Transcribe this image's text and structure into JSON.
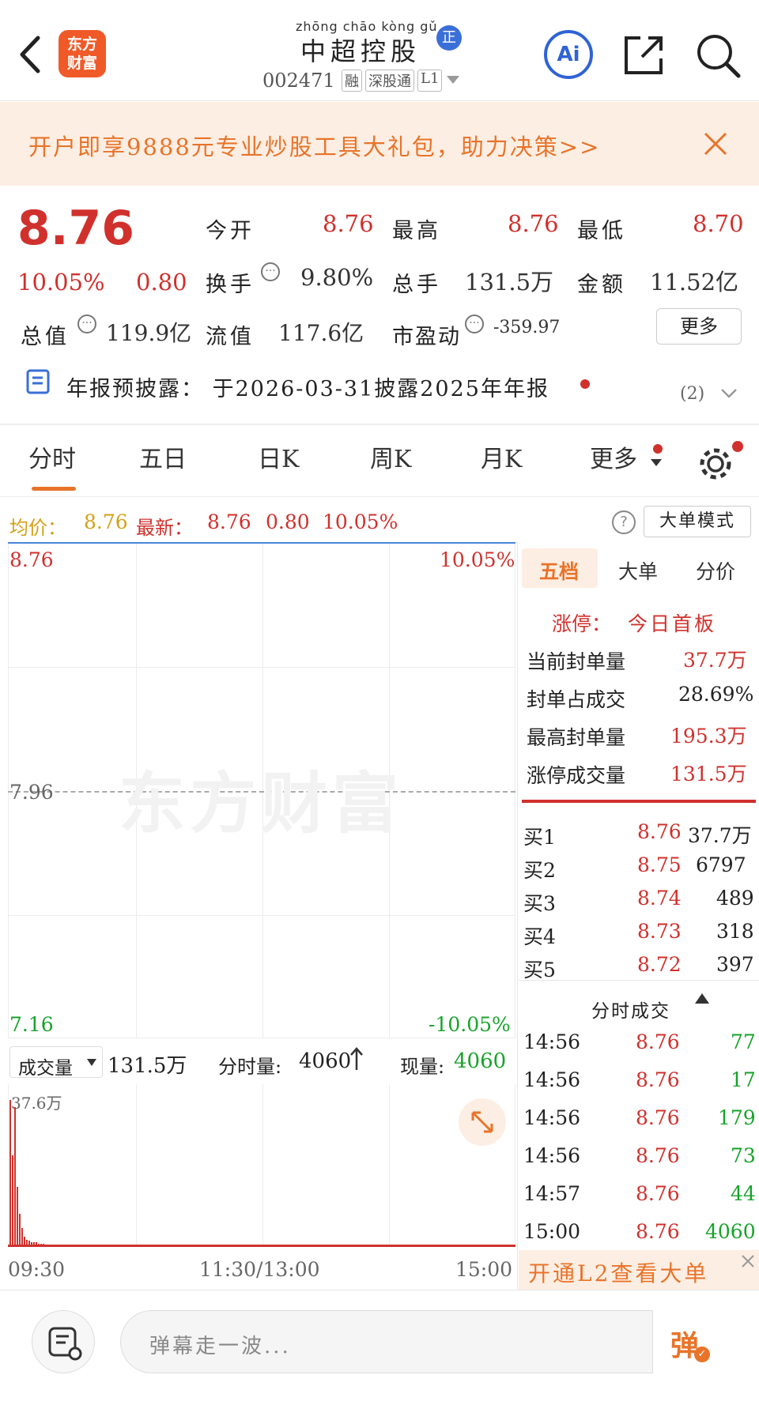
{
  "header": {
    "stock_name_pinyin": "zhōng chāo kòng gǔ",
    "stock_name": "中超控股",
    "badge": "正",
    "code": "002471",
    "tags": [
      "融",
      "深股通",
      "L1"
    ],
    "logo_text": "东方财富",
    "ai_label": "Ai"
  },
  "banner": {
    "text": "开户即享9888元专业炒股工具大礼包，助力决策>>"
  },
  "quote": {
    "price": "8.76",
    "change_pct": "10.05%",
    "change": "0.80",
    "open_label": "今开",
    "open": "8.76",
    "high_label": "最高",
    "high": "8.76",
    "low_label": "最低",
    "low": "8.70",
    "turnover_label": "换手",
    "turnover": "9.80%",
    "volume_label": "总手",
    "volume": "131.5万",
    "amount_label": "金额",
    "amount": "11.52亿",
    "mktcap_label": "总值",
    "mktcap": "119.9亿",
    "float_label": "流值",
    "float": "117.6亿",
    "pe_label": "市盈动",
    "pe": "-359.97",
    "more_label": "更多"
  },
  "notice": {
    "text": "年报预披露：  于2026-03-31披露2025年年报",
    "count": "(2)"
  },
  "tabs": {
    "items": [
      "分时",
      "五日",
      "日K",
      "周K",
      "月K",
      "更多"
    ],
    "active": "分时"
  },
  "info_bar": {
    "avg_label": "均价：",
    "avg": "8.76",
    "last_label": "最新：",
    "last": "8.76",
    "change": "0.80",
    "pct": "10.05%",
    "mode_label": "大单模式"
  },
  "chart": {
    "y_top": "8.76",
    "y_top_pct": "10.05%",
    "y_mid": "7.96",
    "y_bottom": "7.16",
    "y_bottom_pct": "-10.05%",
    "watermark": "东方财富",
    "vol_label": "成交量",
    "vol_value": "131.5万",
    "tick_vol_label": "分时量:",
    "tick_vol": "4060",
    "now_vol_label": "现量:",
    "now_vol": "4060",
    "vol_max": "37.6万",
    "time_start": "09:30",
    "time_mid": "11:30/13:00",
    "time_end": "15:00",
    "vol_bars": [
      1.0,
      0.62,
      0.95,
      0.4,
      0.22,
      0.12,
      0.06,
      0.04,
      0.03,
      0.02,
      0.02,
      0.02,
      0.01,
      0.01,
      0.01
    ]
  },
  "right_panel": {
    "tabs": [
      "五档",
      "大单",
      "分价"
    ],
    "limit_label": "涨停：",
    "limit_value": "今日首板",
    "seal_rows": [
      {
        "label": "当前封单量",
        "value": "37.7万"
      },
      {
        "label": "封单占成交",
        "value": "28.69%"
      },
      {
        "label": "最高封单量",
        "value": "195.3万"
      },
      {
        "label": "涨停成交量",
        "value": "131.5万"
      }
    ],
    "bids": [
      {
        "label": "买1",
        "price": "8.76",
        "vol": "37.7万"
      },
      {
        "label": "买2",
        "price": "8.75",
        "vol": "6797"
      },
      {
        "label": "买3",
        "price": "8.74",
        "vol": "489"
      },
      {
        "label": "买4",
        "price": "8.73",
        "vol": "318"
      },
      {
        "label": "买5",
        "price": "8.72",
        "vol": "397"
      }
    ],
    "trades_label": "分时成交",
    "trades": [
      {
        "time": "14:56",
        "price": "8.76",
        "vol": "77"
      },
      {
        "time": "14:56",
        "price": "8.76",
        "vol": "17"
      },
      {
        "time": "14:56",
        "price": "8.76",
        "vol": "179"
      },
      {
        "time": "14:56",
        "price": "8.76",
        "vol": "73"
      },
      {
        "time": "14:57",
        "price": "8.76",
        "vol": "44"
      },
      {
        "time": "15:00",
        "price": "8.76",
        "vol": "4060"
      }
    ],
    "l2_label": "开通L2查看大单"
  },
  "bottom": {
    "placeholder": "弹幕走一波...",
    "danmu_label": "弹"
  },
  "colors": {
    "up": "#d0312d",
    "down": "#17a32b",
    "accent": "#e8742a",
    "brand": "#f05a28"
  }
}
